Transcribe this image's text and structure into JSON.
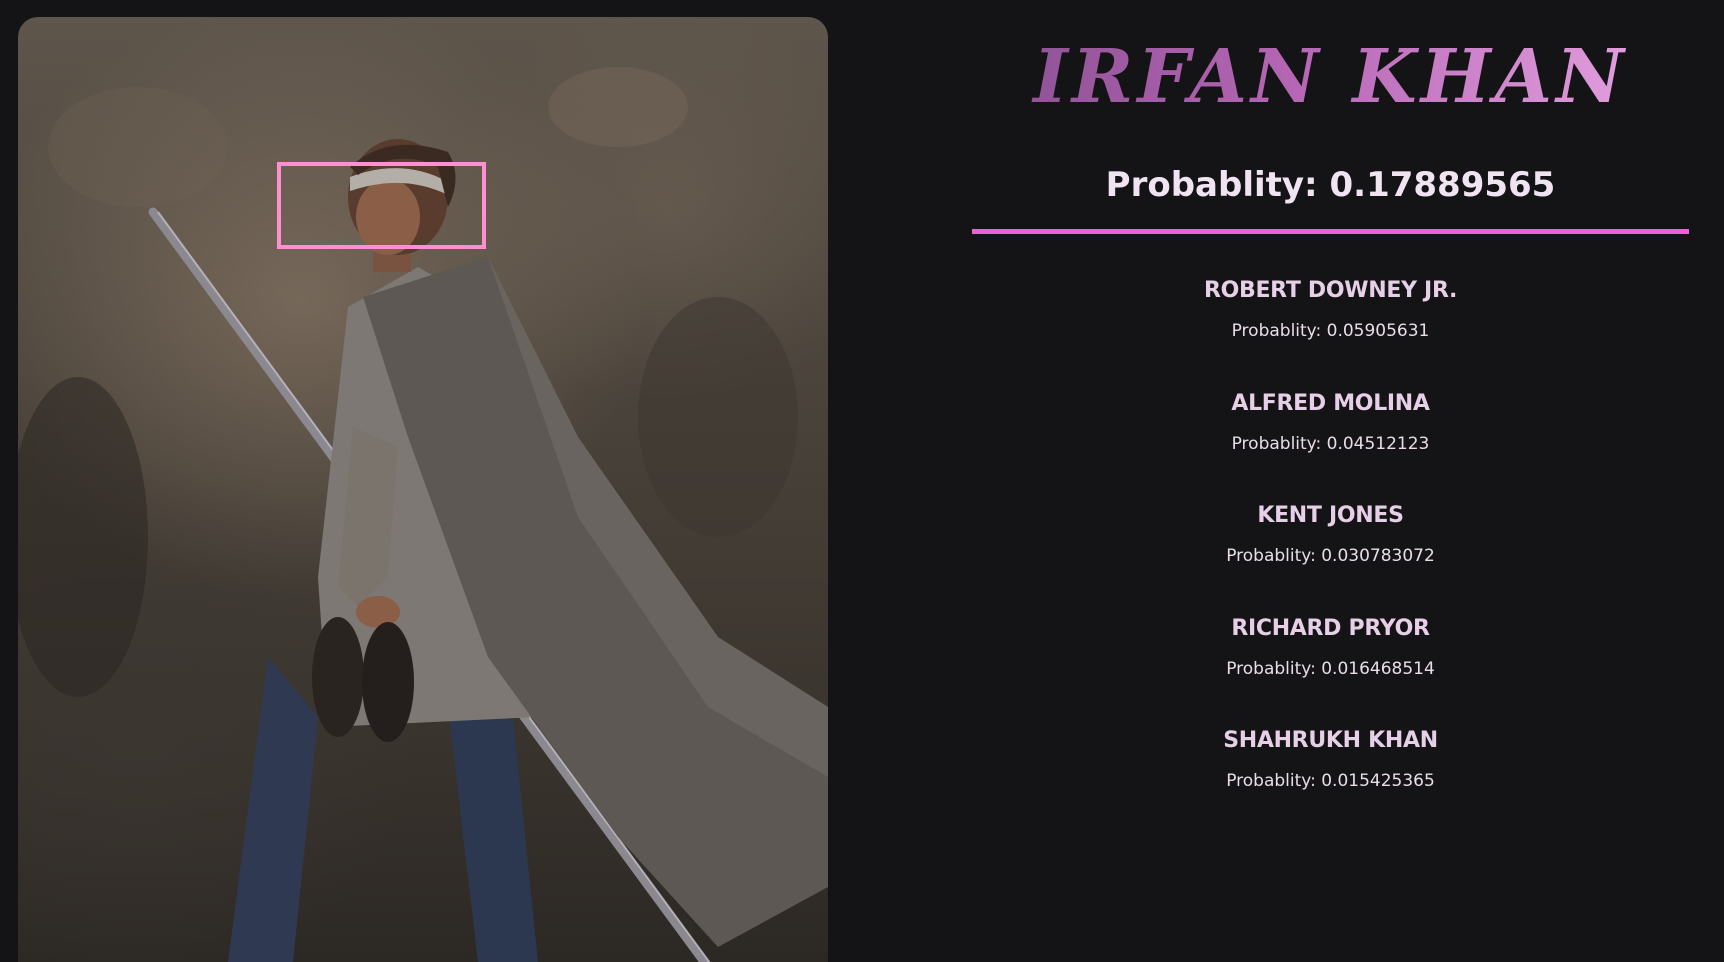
{
  "photo": {
    "subject": "Irfan Khan",
    "face_box_color": "#ff8fd2"
  },
  "top_match": {
    "name": "IRFAN KHAN",
    "probability_text": "Probablity: 0.17889565",
    "probability": 0.17889565
  },
  "accent_color": "#ee5fd8",
  "candidates": [
    {
      "name": "ROBERT DOWNEY JR.",
      "probability_text": "Probablity: 0.05905631",
      "probability": 0.05905631
    },
    {
      "name": "ALFRED MOLINA",
      "probability_text": "Probablity: 0.04512123",
      "probability": 0.04512123
    },
    {
      "name": "KENT JONES",
      "probability_text": "Probablity: 0.030783072",
      "probability": 0.030783072
    },
    {
      "name": "RICHARD PRYOR",
      "probability_text": "Probablity: 0.016468514",
      "probability": 0.016468514
    },
    {
      "name": "SHAHRUKH KHAN",
      "probability_text": "Probablity: 0.015425365",
      "probability": 0.015425365
    }
  ]
}
